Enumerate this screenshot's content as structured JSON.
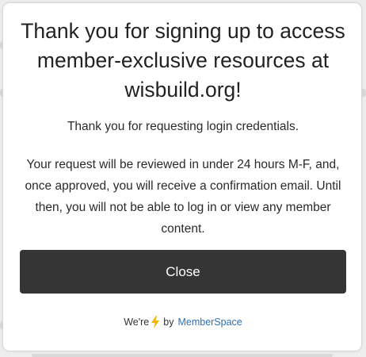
{
  "modal": {
    "title": "Thank you for signing up to access member-exclusive resources at wisbuild.org!",
    "lead": "Thank you for requesting login credentials.",
    "body": "Your request will be reviewed in under 24 hours M-F, and, once approved, you will receive a confirmation email. Until then, you will not be able to log in or view any member content.",
    "close_label": "Close"
  },
  "footer": {
    "prefix": "We're",
    "connector": "by",
    "brand": "MemberSpace",
    "icon": "lightning-bolt-icon"
  },
  "colors": {
    "button_bg": "#353535",
    "link": "#2f6fb3",
    "bolt": "#f5b400"
  }
}
